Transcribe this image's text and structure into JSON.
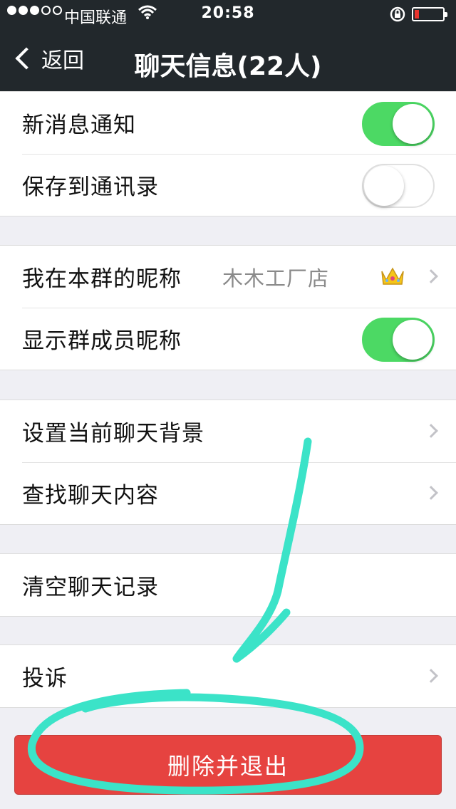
{
  "status_bar": {
    "carrier": "中国联通",
    "time": "20:58",
    "battery_level": 0.15,
    "battery_color": "#e8342e"
  },
  "nav": {
    "back_label": "返回",
    "title": "聊天信息(22人)"
  },
  "groups": {
    "notifications": {
      "new_message_notify": {
        "label": "新消息通知",
        "on": true
      },
      "save_to_contacts": {
        "label": "保存到通讯录",
        "on": false
      }
    },
    "nickname": {
      "my_nickname": {
        "label": "我在本群的昵称",
        "value": "木木工厂店",
        "icon": "crown-icon"
      },
      "show_member_nicknames": {
        "label": "显示群成员昵称",
        "on": true
      }
    },
    "chat": {
      "set_background": {
        "label": "设置当前聊天背景"
      },
      "search_content": {
        "label": "查找聊天内容"
      }
    },
    "clear": {
      "clear_history": {
        "label": "清空聊天记录"
      }
    },
    "report": {
      "complain": {
        "label": "投诉"
      }
    }
  },
  "delete_exit_button": {
    "label": "删除并退出"
  },
  "colors": {
    "toggle_on": "#4cd964",
    "danger": "#e64340",
    "annotation": "#3be3c8"
  }
}
